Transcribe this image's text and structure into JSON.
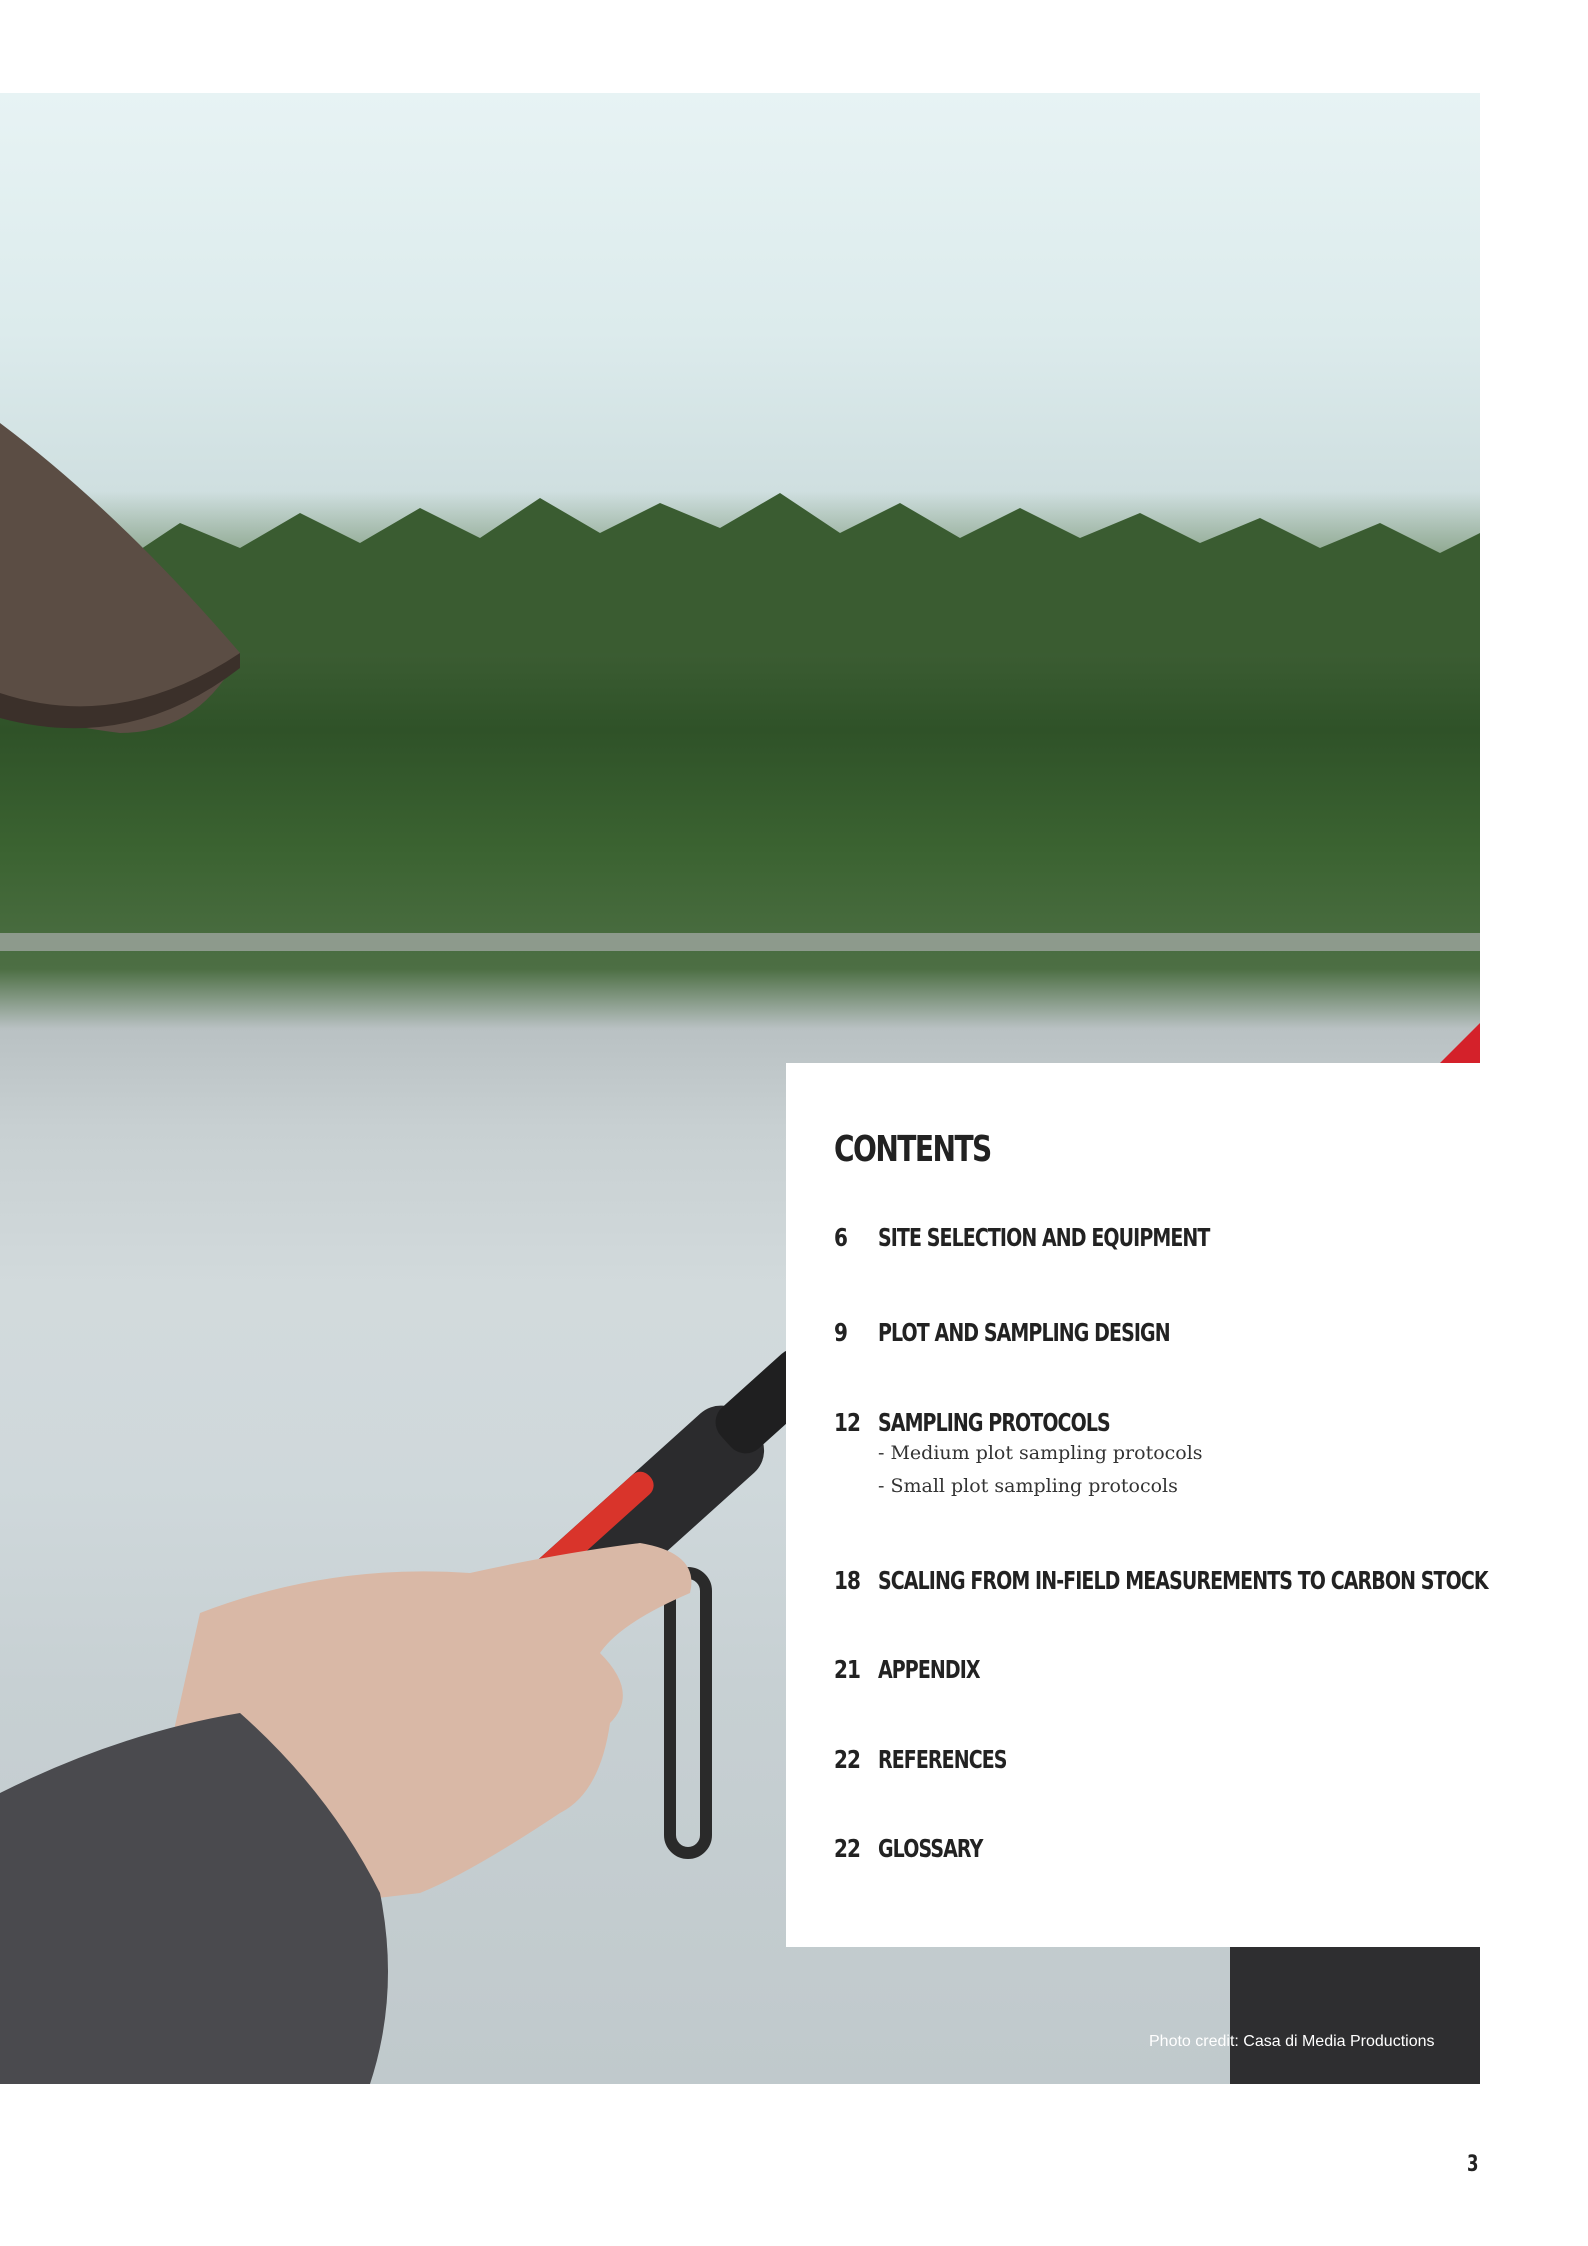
{
  "contents": {
    "title": "CONTENTS",
    "items": [
      {
        "page": "6",
        "label": "SITE SELECTION AND EQUIPMENT",
        "subitems": []
      },
      {
        "page": "9",
        "label": "PLOT AND SAMPLING DESIGN",
        "subitems": []
      },
      {
        "page": "12",
        "label": "SAMPLING PROTOCOLS",
        "subitems": [
          "- Medium plot sampling protocols",
          "- Small plot sampling protocols"
        ]
      },
      {
        "page": "18",
        "label": "SCALING FROM IN-FIELD MEASUREMENTS TO CARBON STOCK",
        "subitems": []
      },
      {
        "page": "21",
        "label": "APPENDIX",
        "subitems": []
      },
      {
        "page": "22",
        "label": "REFERENCES",
        "subitems": []
      },
      {
        "page": "22",
        "label": "GLOSSARY",
        "subitems": []
      }
    ]
  },
  "photo_credit": "Photo credit: Casa di Media Productions",
  "page_number": "3"
}
